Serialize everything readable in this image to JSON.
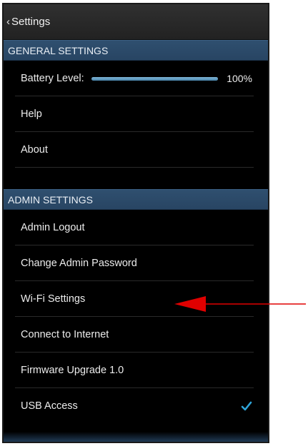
{
  "header": {
    "back_label": "Settings"
  },
  "general": {
    "title": "GENERAL SETTINGS",
    "battery_label": "Battery Level:",
    "battery_percent": 100,
    "battery_value": "100%",
    "help": "Help",
    "about": "About"
  },
  "admin": {
    "title": "ADMIN SETTINGS",
    "logout": "Admin Logout",
    "change_password": "Change Admin Password",
    "wifi": "Wi-Fi Settings",
    "connect": "Connect to Internet",
    "firmware": "Firmware Upgrade  1.0",
    "usb": "USB Access",
    "usb_checked": true
  },
  "colors": {
    "accent": "#2f4f6f",
    "check": "#2fa4d8",
    "annotation_arrow": "#e00000"
  }
}
